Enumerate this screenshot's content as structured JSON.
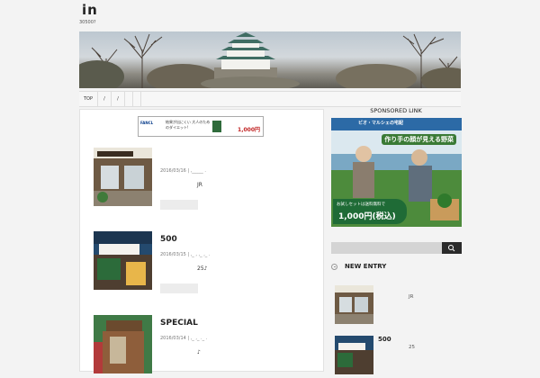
{
  "site": {
    "title": "in",
    "description": "30500?"
  },
  "nav": {
    "items": [
      "TOP",
      "/",
      "/",
      "",
      ""
    ]
  },
  "ad_banner": {
    "brand": "FANCL",
    "text": "結果が出にくい 大人のためのダイエット!",
    "price": "1,000円"
  },
  "posts": [
    {
      "title": "",
      "date": "2016/03/16 | ,_____ .",
      "excerpt": "JR"
    },
    {
      "title": "500",
      "date": "2016/03/15 | ,_ , ,_ ,_ .",
      "excerpt": "25♪"
    },
    {
      "title": "SPECIAL",
      "date": "2016/03/14 | ,_ ,_ ._ .",
      "excerpt": "♪"
    }
  ],
  "sidebar": {
    "sponsored_label": "SPONSORED LINK",
    "ad": {
      "brand": "ビオ・マルシェの宅配",
      "tagline": "作り手の顔が見える野菜",
      "offer_line": "お試しセットは送料無料で",
      "offer_price": "1,000円(税込)"
    },
    "search": {
      "placeholder": ""
    },
    "new_entry_label": "NEW ENTRY",
    "entries": [
      {
        "title": "",
        "excerpt": "JR"
      },
      {
        "title": "500",
        "excerpt": "25"
      }
    ]
  }
}
